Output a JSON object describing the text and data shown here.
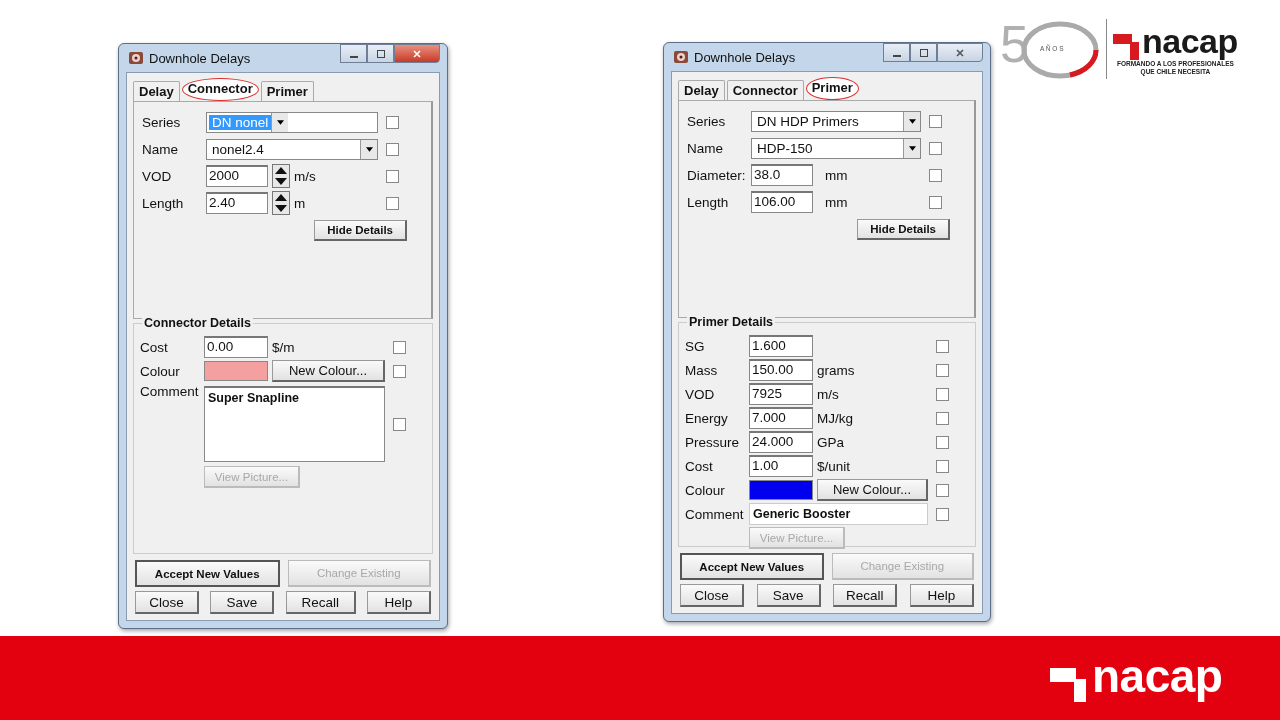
{
  "windows": [
    {
      "title": "Downhole Delays",
      "tabs": [
        {
          "label": "Delay",
          "selected": false,
          "circled": false
        },
        {
          "label": "Connector",
          "selected": true,
          "circled": true
        },
        {
          "label": "Primer",
          "selected": false,
          "circled": false
        }
      ],
      "fields": [
        {
          "kind": "combo",
          "label": "Series",
          "value": "DN nonel",
          "highlighted": true,
          "checked": false
        },
        {
          "kind": "combo",
          "label": "Name",
          "value": "nonel2.4",
          "highlighted": false,
          "checked": false
        },
        {
          "kind": "spin",
          "label": "VOD",
          "value": "2000",
          "unit": "m/s",
          "checked": false
        },
        {
          "kind": "spin",
          "label": "Length",
          "value": "2.40",
          "unit": "m",
          "checked": false
        }
      ],
      "hide_button": "Hide Details",
      "details": {
        "title": "Connector Details",
        "rows": [
          {
            "kind": "text",
            "label": "Cost",
            "value": "0.00",
            "unit": "$/m",
            "checked": false
          },
          {
            "kind": "colour",
            "label": "Colour",
            "color": "#f4a0a0",
            "button": "New Colour...",
            "checked": false
          },
          {
            "kind": "memo",
            "label": "Comment",
            "value": "Super Snapline",
            "checked": false
          }
        ]
      },
      "view_picture": {
        "label": "View Picture...",
        "disabled": true
      },
      "accept": {
        "label": "Accept New Values",
        "disabled": false
      },
      "change": {
        "label": "Change Existing",
        "disabled": true
      },
      "buttons": [
        "Close",
        "Save",
        "Recall",
        "Help"
      ]
    },
    {
      "title": "Downhole Delays",
      "tabs": [
        {
          "label": "Delay",
          "selected": false,
          "circled": false
        },
        {
          "label": "Connector",
          "selected": false,
          "circled": false
        },
        {
          "label": "Primer",
          "selected": true,
          "circled": true
        }
      ],
      "fields": [
        {
          "kind": "combo",
          "label": "Series",
          "value": "DN HDP Primers",
          "highlighted": false,
          "checked": false
        },
        {
          "kind": "combo",
          "label": "Name",
          "value": "HDP-150",
          "highlighted": false,
          "checked": false
        },
        {
          "kind": "text",
          "label": "Diameter:",
          "value": "38.0",
          "unit": "mm",
          "checked": false
        },
        {
          "kind": "text",
          "label": "Length",
          "value": "106.00",
          "unit": "mm",
          "checked": false
        }
      ],
      "hide_button": "Hide Details",
      "details": {
        "title": "Primer Details",
        "rows": [
          {
            "kind": "text",
            "label": "SG",
            "value": "1.600",
            "checked": false
          },
          {
            "kind": "text",
            "label": "Mass",
            "value": "150.00",
            "unit": "grams",
            "checked": false
          },
          {
            "kind": "text",
            "label": "VOD",
            "value": "7925",
            "unit": "m/s",
            "checked": false
          },
          {
            "kind": "text",
            "label": "Energy",
            "value": "7.000",
            "unit": "MJ/kg",
            "checked": false
          },
          {
            "kind": "text",
            "label": "Pressure",
            "value": "24.000",
            "unit": "GPa",
            "checked": false
          },
          {
            "kind": "text",
            "label": "Cost",
            "value": "1.00",
            "unit": "$/unit",
            "checked": false
          },
          {
            "kind": "colour",
            "label": "Colour",
            "color": "#0000ee",
            "button": "New Colour...",
            "checked": false
          },
          {
            "kind": "comment",
            "label": "Comment",
            "value": "Generic Booster",
            "checked": false
          }
        ]
      },
      "view_picture": {
        "label": "View Picture...",
        "disabled": true
      },
      "accept": {
        "label": "Accept New Values",
        "disabled": false
      },
      "change": {
        "label": "Change Existing",
        "disabled": true
      },
      "buttons": [
        "Close",
        "Save",
        "Recall",
        "Help"
      ]
    }
  ],
  "logo_top": {
    "anniversary_digit": "5",
    "anniversary_label": "A Ñ O S",
    "brand": "nacap",
    "tagline": [
      "FORMANDO A LOS PROFESIONALES",
      "QUE CHILE NECESITA"
    ]
  },
  "footer": {
    "brand": "nacap"
  }
}
